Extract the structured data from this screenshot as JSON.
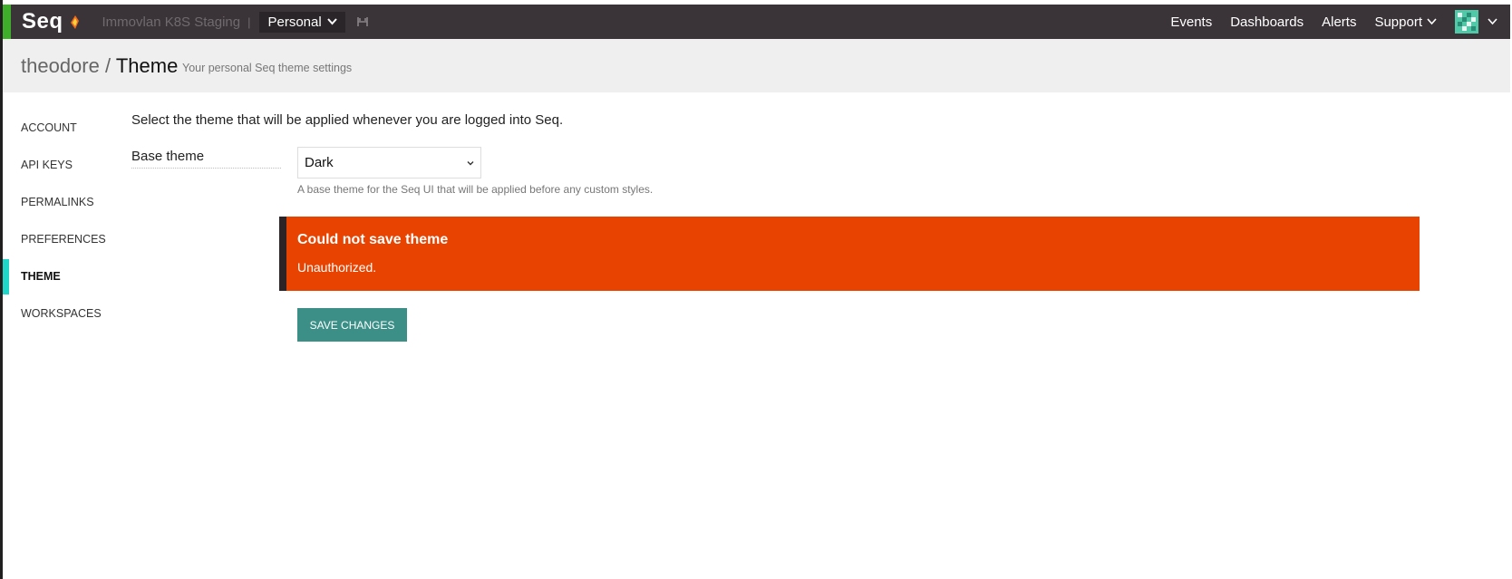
{
  "topbar": {
    "logo": "Seq",
    "instance_name": "Immovlan K8S Staging",
    "separator": "|",
    "workspace": "Personal",
    "nav": {
      "events": "Events",
      "dashboards": "Dashboards",
      "alerts": "Alerts",
      "support": "Support"
    }
  },
  "header": {
    "user": "theodore",
    "slash": "/",
    "page": "Theme",
    "subtitle": "Your personal Seq theme settings"
  },
  "sidebar": {
    "items": [
      {
        "label": "ACCOUNT"
      },
      {
        "label": "API KEYS"
      },
      {
        "label": "PERMALINKS"
      },
      {
        "label": "PREFERENCES"
      },
      {
        "label": "THEME",
        "active": true
      },
      {
        "label": "WORKSPACES"
      }
    ]
  },
  "main": {
    "intro": "Select the theme that will be applied whenever you are logged into Seq.",
    "base_theme_label": "Base theme",
    "base_theme_value": "Dark",
    "base_theme_help": "A base theme for the Seq UI that will be applied before any custom styles.",
    "error_title": "Could not save theme",
    "error_message": "Unauthorized.",
    "save_label": "SAVE CHANGES"
  },
  "colors": {
    "topbar": "#3a3438",
    "accent_green": "#3fae2a",
    "active_indicator": "#1fd6c8",
    "error": "#e84300",
    "save_button": "#3b8f87"
  },
  "icons": [
    "seq-flame-icon",
    "chevron-down-icon",
    "pin-icon",
    "avatar-identicon"
  ]
}
